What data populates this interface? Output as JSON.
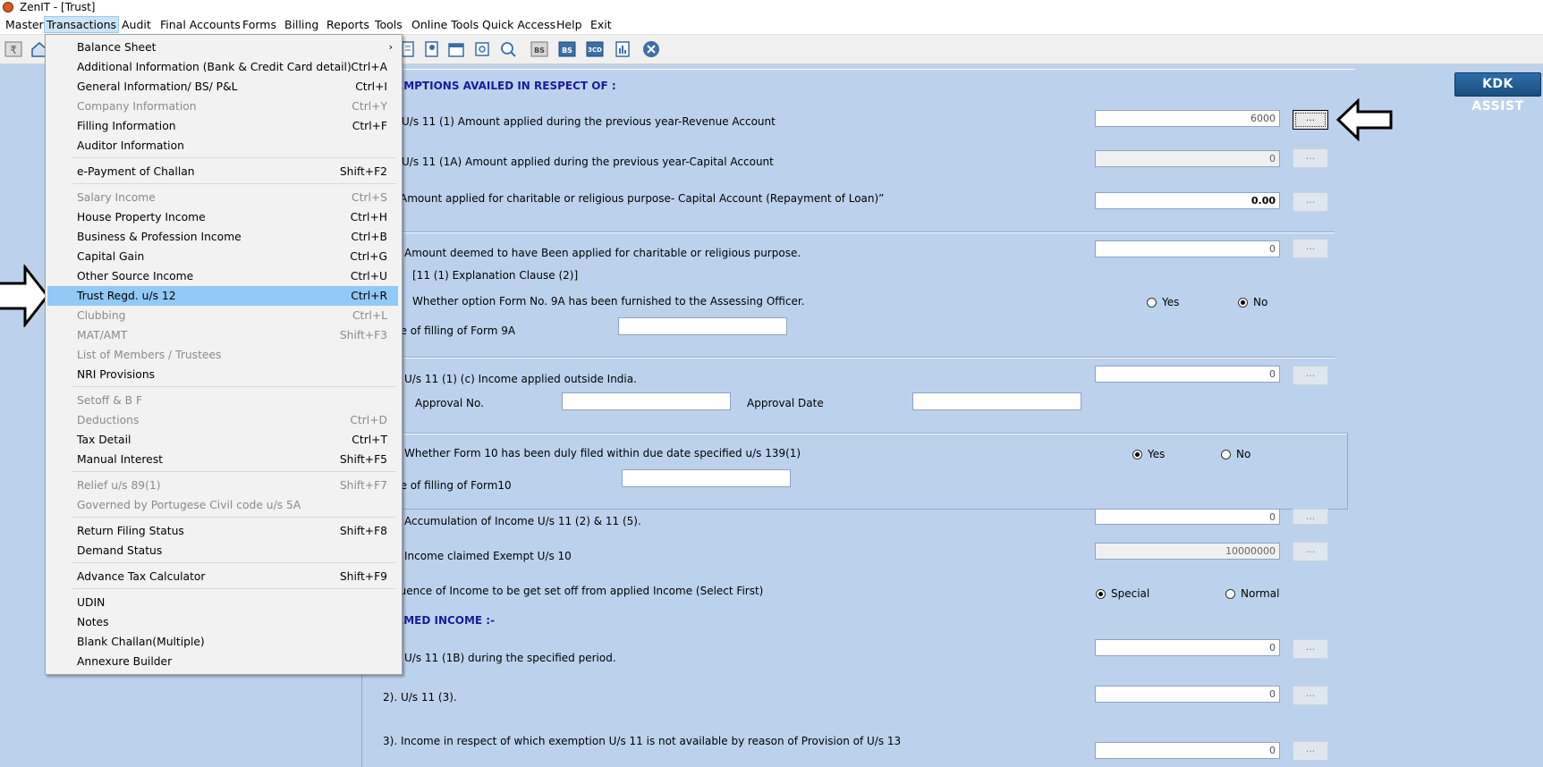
{
  "window": {
    "title": "ZenIT - [Trust]"
  },
  "menubar": [
    "Master",
    "Transactions",
    "Audit",
    "Final Accounts",
    "Forms",
    "Billing",
    "Reports",
    "Tools",
    "Online Tools",
    "Quick Access",
    "Help",
    "Exit"
  ],
  "toolbar": {
    "kdk_assist": "KDK ASSIST",
    "icons": [
      "rupee-icon",
      "home-icon",
      "document-icon",
      "user-doc-icon",
      "calendar-icon",
      "settings-icon",
      "search-icon",
      "bs-icon",
      "bs-alt-icon",
      "3cd-icon",
      "report-icon",
      "close-icon"
    ],
    "bs_text": "BS",
    "cd_text": "3CD"
  },
  "transactions_menu": {
    "groups": [
      [
        {
          "label": "Balance Sheet",
          "shortcut": "",
          "submenu": true,
          "enabled": true
        },
        {
          "label": "Additional Information (Bank & Credit Card detail)",
          "shortcut": "Ctrl+A",
          "enabled": true
        },
        {
          "label": "General Information/ BS/ P&L",
          "shortcut": "Ctrl+I",
          "enabled": true
        },
        {
          "label": "Company Information",
          "shortcut": "Ctrl+Y",
          "enabled": false
        },
        {
          "label": "Filling Information",
          "shortcut": "Ctrl+F",
          "enabled": true
        },
        {
          "label": "Auditor Information",
          "shortcut": "",
          "enabled": true
        }
      ],
      [
        {
          "label": "e-Payment of Challan",
          "shortcut": "Shift+F2",
          "enabled": true
        }
      ],
      [
        {
          "label": "Salary Income",
          "shortcut": "Ctrl+S",
          "enabled": false
        },
        {
          "label": "House Property Income",
          "shortcut": "Ctrl+H",
          "enabled": true
        },
        {
          "label": "Business & Profession Income",
          "shortcut": "Ctrl+B",
          "enabled": true
        },
        {
          "label": "Capital Gain",
          "shortcut": "Ctrl+G",
          "enabled": true
        },
        {
          "label": "Other Source Income",
          "shortcut": "Ctrl+U",
          "enabled": true
        },
        {
          "label": "Trust Regd. u/s 12",
          "shortcut": "Ctrl+R",
          "enabled": true,
          "selected": true
        },
        {
          "label": "Clubbing",
          "shortcut": "Ctrl+L",
          "enabled": false
        },
        {
          "label": "MAT/AMT",
          "shortcut": "Shift+F3",
          "enabled": false
        },
        {
          "label": "List of Members / Trustees",
          "shortcut": "",
          "enabled": false
        },
        {
          "label": "NRI Provisions",
          "shortcut": "",
          "enabled": true
        }
      ],
      [
        {
          "label": "Setoff & B F",
          "shortcut": "",
          "enabled": false
        },
        {
          "label": "Deductions",
          "shortcut": "Ctrl+D",
          "enabled": false
        },
        {
          "label": "Tax Detail",
          "shortcut": "Ctrl+T",
          "enabled": true
        },
        {
          "label": "Manual Interest",
          "shortcut": "Shift+F5",
          "enabled": true
        }
      ],
      [
        {
          "label": "Relief u/s 89(1)",
          "shortcut": "Shift+F7",
          "enabled": false
        },
        {
          "label": "Governed by Portugese Civil code u/s 5A",
          "shortcut": "",
          "enabled": false
        }
      ],
      [
        {
          "label": "Return Filing Status",
          "shortcut": "Shift+F8",
          "enabled": true
        },
        {
          "label": "Demand Status",
          "shortcut": "",
          "enabled": true
        }
      ],
      [
        {
          "label": "Advance Tax Calculator",
          "shortcut": "Shift+F9",
          "enabled": true
        }
      ],
      [
        {
          "label": "UDIN",
          "shortcut": "",
          "enabled": true
        },
        {
          "label": "Notes",
          "shortcut": "",
          "enabled": true
        },
        {
          "label": "Blank Challan(Multiple)",
          "shortcut": "",
          "enabled": true
        },
        {
          "label": "Annexure Builder",
          "shortcut": "",
          "enabled": true
        }
      ]
    ]
  },
  "form": {
    "section1_header": "EMPTIONS AVAILED IN RESPECT OF :",
    "row1": {
      "label": "U/s 11 (1) Amount applied during the previous year-Revenue Account",
      "value": "6000",
      "button": "..."
    },
    "row2": {
      "label": "U/s 11 (1A) Amount applied during the previous year-Capital Account",
      "value": "0",
      "button": "..."
    },
    "row3": {
      "label": "Amount applied for charitable or religious purpose- Capital Account (Repayment of Loan)”",
      "value": "0.00",
      "button": "..."
    },
    "row4": {
      "label": "Amount deemed to have Been applied for charitable or religious purpose.",
      "value": "0",
      "button": "..."
    },
    "row4_clause": "[11 (1) Explanation Clause (2)]",
    "form9a_question": "Whether option Form No. 9A has been furnished to the Assessing Officer.",
    "form9a_yes": "Yes",
    "form9a_no": "No",
    "form9a_date_label": "ce of filling of Form 9A",
    "row5": {
      "label": "U/s 11 (1) (c) Income applied outside India.",
      "value": "0",
      "button": "..."
    },
    "approval_no_label": "Approval No.",
    "approval_date_label": "Approval Date",
    "form10_question": "Whether Form 10 has been duly filed within due date specified u/s 139(1)",
    "form10_yes": "Yes",
    "form10_no": "No",
    "form10_date_label": "ce of filling of Form10",
    "row6": {
      "label": "Accumulation of Income U/s 11 (2) & 11 (5).",
      "value": "0",
      "button": "..."
    },
    "row7": {
      "label": "Income claimed Exempt U/s 10",
      "value": "10000000",
      "button": "..."
    },
    "sequence_label": "quence of Income to be get set off from applied Income (Select First)",
    "seq_special": "Special",
    "seq_normal": "Normal",
    "section2_header": "EMED INCOME :-",
    "d1": {
      "label": "U/s 11 (1B) during the specified period.",
      "value": "0",
      "button": "..."
    },
    "d2": {
      "label": "2).  U/s 11 (3).",
      "value": "0",
      "button": "..."
    },
    "d3": {
      "label": "3).  Income in respect of which exemption U/s 11 is not available by reason of Provision of U/s 13",
      "value": "0",
      "button": "..."
    }
  },
  "colors": {
    "background": "#bcd2ec",
    "menu_highlight": "#91c9f7",
    "header_text": "#1a1a9c",
    "kdk_button": "#1f5a93"
  }
}
